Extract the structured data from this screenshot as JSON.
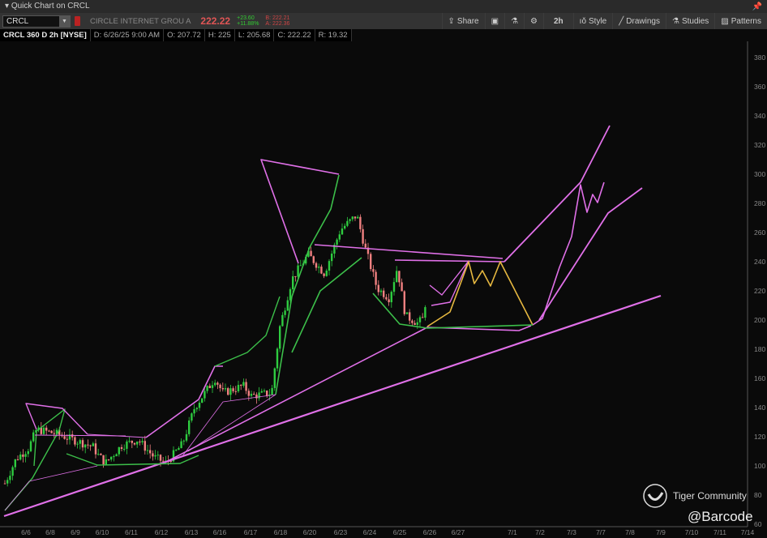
{
  "window": {
    "title": "Quick Chart on CRCL",
    "pin_icon": "pin-icon"
  },
  "toolbar": {
    "symbol": "CRCL",
    "company": "CIRCLE INTERNET GROU A",
    "last": "222.22",
    "change": "+23.60",
    "change_pct": "+11.88%",
    "bid": "B: 222.21",
    "ask": "A: 222.36",
    "buttons": [
      {
        "label": "Share",
        "icon": "share-icon"
      },
      {
        "label": "",
        "icon": "chart-alert-icon"
      },
      {
        "label": "",
        "icon": "flask-icon"
      },
      {
        "label": "",
        "icon": "gear-icon"
      },
      {
        "label": "2h",
        "icon": ""
      },
      {
        "label": "Style",
        "icon": "style-icon"
      },
      {
        "label": "Drawings",
        "icon": "pencil-icon"
      },
      {
        "label": "Studies",
        "icon": "flask-icon"
      },
      {
        "label": "Patterns",
        "icon": "patterns-icon"
      }
    ]
  },
  "info": {
    "title": "CRCL 360 D 2h [NYSE]",
    "date": "D: 6/26/25 9:00 AM",
    "open": "O: 207.72",
    "high": "H: 225",
    "low": "L: 205.68",
    "close": "C: 222.22",
    "range": "R: 19.32"
  },
  "chart_data": {
    "type": "candlestick",
    "ylim": [
      60,
      390
    ],
    "y_ticks": [
      "380",
      "360",
      "340",
      "320",
      "300",
      "280",
      "260",
      "240",
      "220",
      "200",
      "180",
      "160",
      "140",
      "120",
      "100",
      "80",
      "60"
    ],
    "x_ticks": [
      "6/6",
      "6/8",
      "6/9",
      "6/10",
      "6/11",
      "6/12",
      "6/13",
      "6/16",
      "6/17",
      "6/18",
      "6/20",
      "6/23",
      "6/24",
      "6/25",
      "6/26",
      "6/27",
      "7/1",
      "7/2",
      "7/3",
      "7/7",
      "7/8",
      "7/9",
      "7/10",
      "7/11",
      "7/14"
    ],
    "last_bar": {
      "date": "6/26/25 9:00 AM",
      "open": 207.72,
      "high": 225,
      "low": 205.68,
      "close": 222.22
    },
    "colors": {
      "up": "#2ecc40",
      "down": "#f08080",
      "drawing_pink": "#e070e8",
      "drawing_green": "#3cbf4a",
      "drawing_yellow": "#e6b840"
    }
  },
  "watermark": {
    "brand": "Tiger Community",
    "handle": "@Barcode"
  }
}
